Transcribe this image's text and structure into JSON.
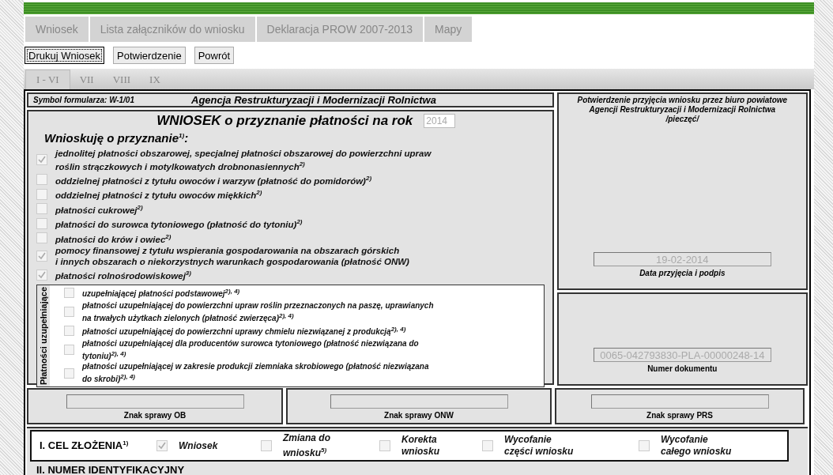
{
  "top_tabs": [
    {
      "label": "Wniosek"
    },
    {
      "label": "Lista załączników do wniosku"
    },
    {
      "label": "Deklaracja PROW 2007-2013"
    },
    {
      "label": "Mapy"
    }
  ],
  "buttons": [
    {
      "label": "Drukuj Wniosek",
      "focused": true
    },
    {
      "label": "Potwierdzenie",
      "focused": false
    },
    {
      "label": "Powrót",
      "focused": false
    }
  ],
  "section_tabs": [
    {
      "label": "I - VI",
      "selected": true
    },
    {
      "label": "VII",
      "selected": false
    },
    {
      "label": "VIII",
      "selected": false
    },
    {
      "label": "IX",
      "selected": false
    }
  ],
  "form": {
    "symbol": "Symbol formularza: W-1/01",
    "agency": "Agencja Restrukturyzacji i Modernizacji Rolnictwa",
    "title": "WNIOSEK o przyznanie płatności na rok",
    "year": "2014",
    "subtitle": "Wnioskuję o przyznanie$^{1)}$:",
    "payments": [
      {
        "lines": [
          "jednolitej płatności obszarowej, specjalnej płatności obszarowej do powierzchni upraw",
          "roślin strączkowych i motylkowatych drobnonasiennych$^{2)}$"
        ],
        "checked": true
      },
      {
        "lines": [
          "oddzielnej płatności z tytułu owoców i warzyw (płatność do pomidorów)$^{2)}$"
        ],
        "checked": false
      },
      {
        "lines": [
          "oddzielnej płatności z tytułu owoców miękkich$^{2)}$"
        ],
        "checked": false
      },
      {
        "lines": [
          "płatności cukrowej$^{2)}$"
        ],
        "checked": false
      },
      {
        "lines": [
          "płatności do surowca tytoniowego (płatność do tytoniu)$^{2)}$"
        ],
        "checked": false
      },
      {
        "lines": [
          "płatności do krów i owiec$^{2)}$"
        ],
        "checked": false
      },
      {
        "lines": [
          "pomocy finansowej z tytułu wspierania gospodarowania na obszarach górskich",
          "i innych obszarach o niekorzystnych warunkach gospodarowania (płatność ONW)"
        ],
        "checked": true
      },
      {
        "lines": [
          "płatności rolnośrodowiskowej$^{3)}$"
        ],
        "checked": true
      }
    ],
    "supplementary": {
      "title": "Płatności uzupełniające",
      "items": [
        {
          "lines": [
            "uzupełniającej płatności podstawowej$^{2), 4)}$"
          ],
          "checked": false
        },
        {
          "lines": [
            "płatności uzupełniającej do powierzchni upraw roślin przeznaczonych na paszę, uprawianych",
            "na trwałych użytkach zielonych (płatność zwierzęca)$^{2), 4)}$"
          ],
          "checked": false
        },
        {
          "lines": [
            "płatności uzupełniającej do powierzchni uprawy chmielu niezwiązanej z produkcją$^{2), 4)}$"
          ],
          "checked": false
        },
        {
          "lines": [
            "płatności uzupełniającej dla producentów surowca tytoniowego (płatność niezwiązana do",
            "tytoniu)$^{2), 4)}$"
          ],
          "checked": false
        },
        {
          "lines": [
            "płatności uzupełniającej w zakresie produkcji ziemniaka skrobiowego (płatność niezwiązana",
            "do skrobi)$^{2), 4)}$"
          ],
          "checked": false
        }
      ]
    },
    "confirmation": {
      "lines": [
        "Potwierdzenie przyjęcia wniosku przez biuro powiatowe",
        "Agencji Restrukturyzacji i Modernizacji Rolnictwa",
        "/pieczęć/"
      ],
      "date": "19-02-2014",
      "date_label": "Data przyjęcia i podpis"
    },
    "document": {
      "number": "0065-042793830-PLA-00000248-14",
      "label": "Numer dokumentu"
    },
    "case_fields": [
      {
        "label": "Znak sprawy OB"
      },
      {
        "label": "Znak sprawy ONW"
      },
      {
        "label": "Znak sprawy PRS"
      }
    ]
  },
  "section_1": {
    "title": "I. CEL ZŁOŻENIA$^{1)}$",
    "options": [
      {
        "lines": [
          "Wniosek"
        ],
        "checked": true
      },
      {
        "lines": [
          "Zmiana do",
          "wniosku$^{5)}$"
        ],
        "checked": false
      },
      {
        "lines": [
          "Korekta",
          "wniosku"
        ],
        "checked": false
      },
      {
        "lines": [
          "Wycofanie",
          "części wniosku"
        ],
        "checked": false
      },
      {
        "lines": [
          "Wycofanie",
          "całego wniosku"
        ],
        "checked": false
      }
    ]
  },
  "section_2": {
    "title": "II. NUMER IDENTYFIKACYJNY"
  }
}
